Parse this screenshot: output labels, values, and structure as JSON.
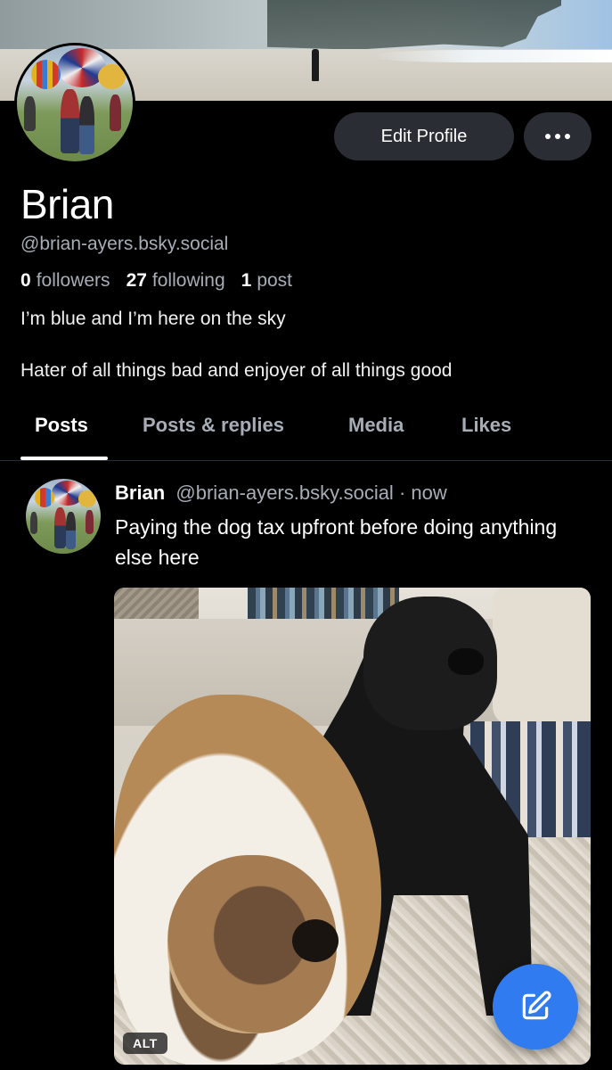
{
  "profile": {
    "display_name": "Brian",
    "handle": "@brian-ayers.bsky.social",
    "followers_count": "0",
    "followers_label": "followers",
    "following_count": "27",
    "following_label": "following",
    "posts_count": "1",
    "posts_label": "post",
    "bio_line1": "I’m blue and I’m here on the sky",
    "bio_line2": "Hater of all things bad and enjoyer of all things good"
  },
  "actions": {
    "edit_profile_label": "Edit Profile",
    "more_icon": "ellipsis-icon"
  },
  "tabs": [
    {
      "label": "Posts",
      "active": true
    },
    {
      "label": "Posts & replies",
      "active": false
    },
    {
      "label": "Media",
      "active": false
    },
    {
      "label": "Likes",
      "active": false
    }
  ],
  "post": {
    "author_name": "Brian",
    "author_handle": "@brian-ayers.bsky.social",
    "separator": "·",
    "time": "now",
    "text": "Paying the dog tax upfront before doing anything else here",
    "image_alt_badge": "ALT"
  },
  "fab": {
    "icon": "compose-icon"
  },
  "colors": {
    "background": "#000000",
    "button_bg": "#2a2d33",
    "muted_text": "#a6adb6",
    "accent": "#2f7bef"
  }
}
